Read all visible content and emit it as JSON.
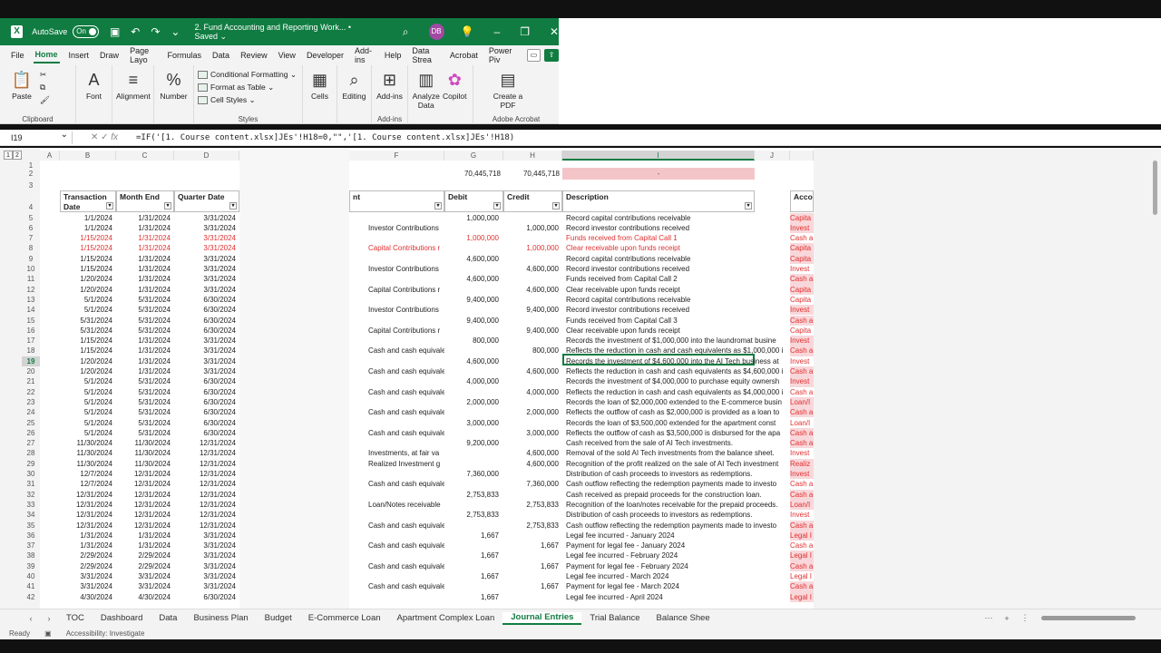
{
  "titlebar": {
    "app_icon": "excel-logo-icon",
    "autosave_label": "AutoSave",
    "autosave_state": "On",
    "doc_title": "2. Fund Accounting and Reporting Work... • Saved ⌄",
    "avatar_initials": "DB"
  },
  "menu": [
    "File",
    "Home",
    "Insert",
    "Draw",
    "Page Layo",
    "Formulas",
    "Data",
    "Review",
    "View",
    "Developer",
    "Add-ins",
    "Help",
    "Data Strea",
    "Acrobat",
    "Power Piv"
  ],
  "ribbon": {
    "paste": "Paste",
    "clipboard": "Clipboard",
    "font": "Font",
    "alignment": "Alignment",
    "number": "Number",
    "conditional_formatting": "Conditional Formatting ⌄",
    "format_as_table": "Format as Table ⌄",
    "cell_styles": "Cell Styles ⌄",
    "styles": "Styles",
    "cells": "Cells",
    "editing": "Editing",
    "addins": "Add-ins",
    "addins_group": "Add-ins",
    "analyze_data": "Analyze Data",
    "copilot": "Copilot",
    "create_pdf": "Create a PDF",
    "adobe_acrobat": "Adobe Acrobat"
  },
  "formula_bar": {
    "name_box": "I19",
    "fx": "fx",
    "formula": "=IF('[1. Course content.xlsx]JEs'!H18=0,\"\",'[1. Course content.xlsx]JEs'!H18)"
  },
  "columns": {
    "A": "A",
    "B": "B",
    "C": "C",
    "D": "D",
    "F": "F",
    "G": "G",
    "H": "H",
    "I": "I",
    "J": "J"
  },
  "totals": {
    "debit": "70,445,718",
    "credit": "70,445,718",
    "diff": "-"
  },
  "headers": {
    "transaction_date": "Transaction Date",
    "month_end": "Month End",
    "quarter_date": "Quarter Date",
    "account": "nt",
    "debit": "Debit",
    "credit": "Credit",
    "description": "Description",
    "account_right": "Accou"
  },
  "rows": [
    {
      "n": "5",
      "td": "1/1/2024",
      "me": "1/31/2024",
      "qd": "3/31/2024",
      "f": "",
      "g": "1,000,000",
      "h": "",
      "i": "Record capital contributions receivable",
      "k": "Capita",
      "red": false
    },
    {
      "n": "6",
      "td": "1/1/2024",
      "me": "1/31/2024",
      "qd": "3/31/2024",
      "f": "Investor Contributions",
      "g": "",
      "h": "1,000,000",
      "i": "Record investor contributions received",
      "k": "Invest",
      "red": false
    },
    {
      "n": "7",
      "td": "1/15/2024",
      "me": "1/31/2024",
      "qd": "3/31/2024",
      "f": "",
      "g": "1,000,000",
      "h": "",
      "i": "Funds received from Capital Call 1",
      "k": "Cash a",
      "red": true
    },
    {
      "n": "8",
      "td": "1/15/2024",
      "me": "1/31/2024",
      "qd": "3/31/2024",
      "f": "Capital Contributions r",
      "g": "",
      "h": "1,000,000",
      "i": "Clear receivable upon funds receipt",
      "k": "Capita",
      "red": true
    },
    {
      "n": "9",
      "td": "1/15/2024",
      "me": "1/31/2024",
      "qd": "3/31/2024",
      "f": "",
      "g": "4,600,000",
      "h": "",
      "i": "Record capital contributions receivable",
      "k": "Capita",
      "red": false
    },
    {
      "n": "10",
      "td": "1/15/2024",
      "me": "1/31/2024",
      "qd": "3/31/2024",
      "f": "Investor Contributions",
      "g": "",
      "h": "4,600,000",
      "i": "Record investor contributions received",
      "k": "Invest",
      "red": false
    },
    {
      "n": "11",
      "td": "1/20/2024",
      "me": "1/31/2024",
      "qd": "3/31/2024",
      "f": "",
      "g": "4,600,000",
      "h": "",
      "i": "Funds received from Capital Call 2",
      "k": "Cash a",
      "red": false
    },
    {
      "n": "12",
      "td": "1/20/2024",
      "me": "1/31/2024",
      "qd": "3/31/2024",
      "f": "Capital Contributions r",
      "g": "",
      "h": "4,600,000",
      "i": "Clear receivable upon funds receipt",
      "k": "Capita",
      "red": false
    },
    {
      "n": "13",
      "td": "5/1/2024",
      "me": "5/31/2024",
      "qd": "6/30/2024",
      "f": "",
      "g": "9,400,000",
      "h": "",
      "i": "Record capital contributions receivable",
      "k": "Capita",
      "red": false
    },
    {
      "n": "14",
      "td": "5/1/2024",
      "me": "5/31/2024",
      "qd": "6/30/2024",
      "f": "Investor Contributions",
      "g": "",
      "h": "9,400,000",
      "i": "Record investor contributions received",
      "k": "Invest",
      "red": false
    },
    {
      "n": "15",
      "td": "5/31/2024",
      "me": "5/31/2024",
      "qd": "6/30/2024",
      "f": "",
      "g": "9,400,000",
      "h": "",
      "i": "Funds received from Capital Call 3",
      "k": "Cash a",
      "red": false
    },
    {
      "n": "16",
      "td": "5/31/2024",
      "me": "5/31/2024",
      "qd": "6/30/2024",
      "f": "Capital Contributions r",
      "g": "",
      "h": "9,400,000",
      "i": "Clear receivable upon funds receipt",
      "k": "Capita",
      "red": false
    },
    {
      "n": "17",
      "td": "1/15/2024",
      "me": "1/31/2024",
      "qd": "3/31/2024",
      "f": "",
      "g": "800,000",
      "h": "",
      "i": "Records the investment of $1,000,000 into the laundromat busine",
      "k": "Invest",
      "red": false
    },
    {
      "n": "18",
      "td": "1/15/2024",
      "me": "1/31/2024",
      "qd": "3/31/2024",
      "f": "Cash and cash equivale",
      "g": "",
      "h": "800,000",
      "i": "Reflects the reduction in cash and cash equivalents as $1,000,000 i",
      "k": "Cash a",
      "red": false
    },
    {
      "n": "19",
      "td": "1/20/2024",
      "me": "1/31/2024",
      "qd": "3/31/2024",
      "f": "",
      "g": "4,600,000",
      "h": "",
      "i": "Records the investment of $4,600,000 into the AI Tech business at",
      "k": "Invest",
      "red": false
    },
    {
      "n": "20",
      "td": "1/20/2024",
      "me": "1/31/2024",
      "qd": "3/31/2024",
      "f": "Cash and cash equivale",
      "g": "",
      "h": "4,600,000",
      "i": "Reflects the reduction in cash and cash equivalents as $4,600,000 i",
      "k": "Cash a",
      "red": false
    },
    {
      "n": "21",
      "td": "5/1/2024",
      "me": "5/31/2024",
      "qd": "6/30/2024",
      "f": "",
      "g": "4,000,000",
      "h": "",
      "i": "Records the investment of $4,000,000 to purchase equity ownersh",
      "k": "Invest",
      "red": false
    },
    {
      "n": "22",
      "td": "5/1/2024",
      "me": "5/31/2024",
      "qd": "6/30/2024",
      "f": "Cash and cash equivale",
      "g": "",
      "h": "4,000,000",
      "i": "Reflects the reduction in cash and cash equivalents as $4,000,000 i",
      "k": "Cash a",
      "red": false
    },
    {
      "n": "23",
      "td": "5/1/2024",
      "me": "5/31/2024",
      "qd": "6/30/2024",
      "f": "",
      "g": "2,000,000",
      "h": "",
      "i": "Records the loan of $2,000,000 extended to the E-commerce busin",
      "k": "Loan/I",
      "red": false
    },
    {
      "n": "24",
      "td": "5/1/2024",
      "me": "5/31/2024",
      "qd": "6/30/2024",
      "f": "Cash and cash equivale",
      "g": "",
      "h": "2,000,000",
      "i": "Reflects the outflow of cash as $2,000,000 is provided as a loan to",
      "k": "Cash a",
      "red": false
    },
    {
      "n": "25",
      "td": "5/1/2024",
      "me": "5/31/2024",
      "qd": "6/30/2024",
      "f": "",
      "g": "3,000,000",
      "h": "",
      "i": "Records the loan of $3,500,000 extended for the apartment const",
      "k": "Loan/I",
      "red": false
    },
    {
      "n": "26",
      "td": "5/1/2024",
      "me": "5/31/2024",
      "qd": "6/30/2024",
      "f": "Cash and cash equivale",
      "g": "",
      "h": "3,000,000",
      "i": "Reflects the outflow of cash as $3,500,000 is disbursed for the apa",
      "k": "Cash a",
      "red": false
    },
    {
      "n": "27",
      "td": "11/30/2024",
      "me": "11/30/2024",
      "qd": "12/31/2024",
      "f": "",
      "g": "9,200,000",
      "h": "",
      "i": "Cash received from the sale of AI Tech investments.",
      "k": "Cash a",
      "red": false
    },
    {
      "n": "28",
      "td": "11/30/2024",
      "me": "11/30/2024",
      "qd": "12/31/2024",
      "f": "Investments, at fair va",
      "g": "",
      "h": "4,600,000",
      "i": "Removal of the sold AI Tech investments from the balance sheet.",
      "k": "Invest",
      "red": false
    },
    {
      "n": "29",
      "td": "11/30/2024",
      "me": "11/30/2024",
      "qd": "12/31/2024",
      "f": "Realized Investment g",
      "g": "",
      "h": "4,600,000",
      "i": "Recognition of the profit realized on the sale of AI Tech investment",
      "k": "Realiz",
      "red": false
    },
    {
      "n": "30",
      "td": "12/7/2024",
      "me": "12/31/2024",
      "qd": "12/31/2024",
      "f": "",
      "g": "7,360,000",
      "h": "",
      "i": "Distribution of cash proceeds to investors as redemptions.",
      "k": "Invest",
      "red": false
    },
    {
      "n": "31",
      "td": "12/7/2024",
      "me": "12/31/2024",
      "qd": "12/31/2024",
      "f": "Cash and cash equivale",
      "g": "",
      "h": "7,360,000",
      "i": "Cash outflow reflecting the redemption payments made to investo",
      "k": "Cash a",
      "red": false
    },
    {
      "n": "32",
      "td": "12/31/2024",
      "me": "12/31/2024",
      "qd": "12/31/2024",
      "f": "",
      "g": "2,753,833",
      "h": "",
      "i": "Cash received as prepaid proceeds for the construction loan.",
      "k": "Cash a",
      "red": false
    },
    {
      "n": "33",
      "td": "12/31/2024",
      "me": "12/31/2024",
      "qd": "12/31/2024",
      "f": "Loan/Notes receivable",
      "g": "",
      "h": "2,753,833",
      "i": "Recognition of the loan/notes receivable for the prepaid proceeds.",
      "k": "Loan/I",
      "red": false
    },
    {
      "n": "34",
      "td": "12/31/2024",
      "me": "12/31/2024",
      "qd": "12/31/2024",
      "f": "",
      "g": "2,753,833",
      "h": "",
      "i": "Distribution of cash proceeds to investors as redemptions.",
      "k": "Invest",
      "red": false
    },
    {
      "n": "35",
      "td": "12/31/2024",
      "me": "12/31/2024",
      "qd": "12/31/2024",
      "f": "Cash and cash equivale",
      "g": "",
      "h": "2,753,833",
      "i": "Cash outflow reflecting the redemption payments made to investo",
      "k": "Cash a",
      "red": false
    },
    {
      "n": "36",
      "td": "1/31/2024",
      "me": "1/31/2024",
      "qd": "3/31/2024",
      "f": "",
      "g": "1,667",
      "h": "",
      "i": "Legal fee incurred - January 2024",
      "k": "Legal I",
      "red": false
    },
    {
      "n": "37",
      "td": "1/31/2024",
      "me": "1/31/2024",
      "qd": "3/31/2024",
      "f": "Cash and cash equivale",
      "g": "",
      "h": "1,667",
      "i": "Payment for legal fee - January 2024",
      "k": "Cash a",
      "red": false
    },
    {
      "n": "38",
      "td": "2/29/2024",
      "me": "2/29/2024",
      "qd": "3/31/2024",
      "f": "",
      "g": "1,667",
      "h": "",
      "i": "Legal fee incurred - February 2024",
      "k": "Legal I",
      "red": false
    },
    {
      "n": "39",
      "td": "2/29/2024",
      "me": "2/29/2024",
      "qd": "3/31/2024",
      "f": "Cash and cash equivale",
      "g": "",
      "h": "1,667",
      "i": "Payment for legal fee - February 2024",
      "k": "Cash a",
      "red": false
    },
    {
      "n": "40",
      "td": "3/31/2024",
      "me": "3/31/2024",
      "qd": "3/31/2024",
      "f": "",
      "g": "1,667",
      "h": "",
      "i": "Legal fee incurred - March 2024",
      "k": "Legal I",
      "red": false
    },
    {
      "n": "41",
      "td": "3/31/2024",
      "me": "3/31/2024",
      "qd": "3/31/2024",
      "f": "Cash and cash equivale",
      "g": "",
      "h": "1,667",
      "i": "Payment for legal fee - March 2024",
      "k": "Cash a",
      "red": false
    },
    {
      "n": "42",
      "td": "4/30/2024",
      "me": "4/30/2024",
      "qd": "6/30/2024",
      "f": "",
      "g": "1,667",
      "h": "",
      "i": "Legal fee incurred - April 2024",
      "k": "Legal I",
      "red": false
    }
  ],
  "sheet_tabs": [
    "TOC",
    "Dashboard",
    "Data",
    "Business Plan",
    "Budget",
    "E-Commerce Loan",
    "Apartment Complex Loan",
    "Journal Entries",
    "Trial Balance",
    "Balance Shee"
  ],
  "active_tab": "Journal Entries",
  "status": {
    "ready": "Ready",
    "accessibility": "Accessibility: Investigate"
  }
}
